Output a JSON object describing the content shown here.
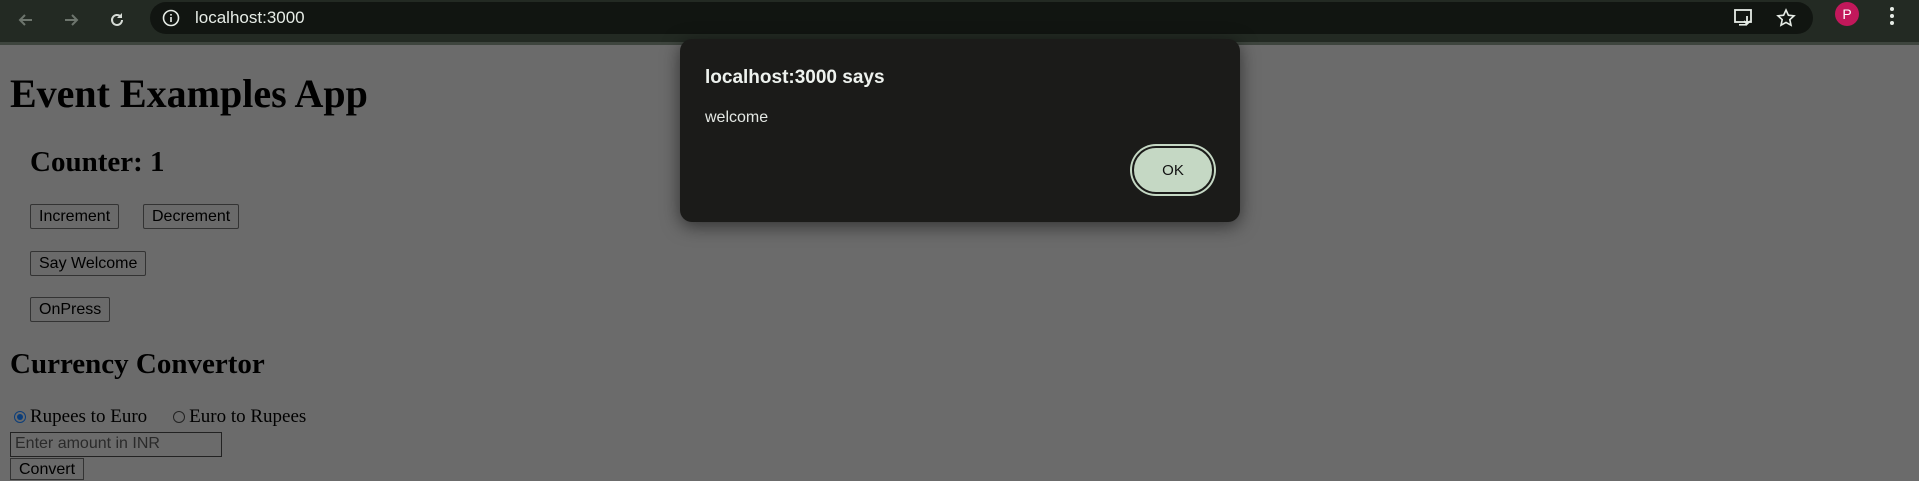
{
  "browser": {
    "url": "localhost:3000",
    "profile_initial": "P"
  },
  "page": {
    "title": "Event Examples App",
    "counter_label": "Counter: 1",
    "buttons": {
      "increment": "Increment",
      "decrement": "Decrement",
      "say_welcome": "Say Welcome",
      "onpress": "OnPress"
    },
    "currency": {
      "heading": "Currency Convertor",
      "radio_rupees_to_euro": "Rupees to Euro",
      "radio_euro_to_rupees": "Euro to Rupees",
      "selected": "Rupees to Euro",
      "amount_placeholder": "Enter amount in INR",
      "convert_label": "Convert"
    }
  },
  "dialog": {
    "title": "localhost:3000 says",
    "message": "welcome",
    "ok_label": "OK"
  },
  "colors": {
    "chrome_bg": "#232a23",
    "dialog_bg": "#1b1b19",
    "ok_button": "#c5d8c4",
    "avatar": "#c2185b",
    "overlay_page": "#6b6b6b"
  }
}
